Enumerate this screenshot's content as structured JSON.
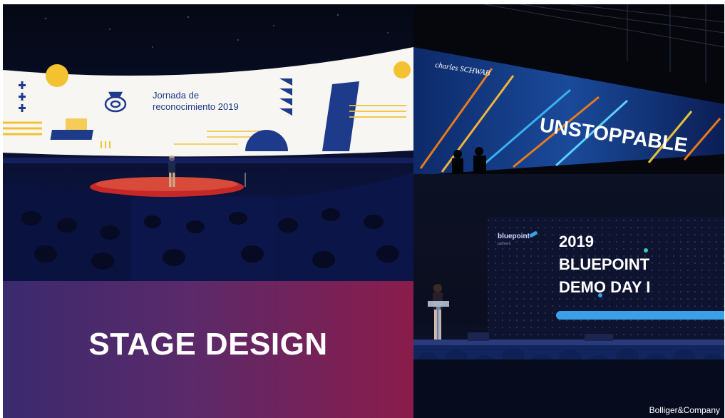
{
  "panels": {
    "correos": {
      "screen_text_line1": "Jornada de",
      "screen_text_line2": "reconocimiento 2019"
    },
    "schwab": {
      "brand": "charles SCHWAB",
      "headline": "UNSTOPPABLE"
    },
    "title": {
      "heading": "STAGE DESIGN"
    },
    "bluepoint": {
      "brand": "bluepoint",
      "brand_sub": "partners",
      "line1": "2019",
      "line2": "BLUEPOINT",
      "line3": "DEMO DAY I",
      "credit": "Bolliger&Company"
    }
  },
  "colors": {
    "correos_yellow": "#f2c230",
    "correos_blue": "#1e3a8a",
    "title_gradient_start": "#3a2a6e",
    "title_gradient_end": "#8a1c4a",
    "bluepoint_accent": "#3aa0e8"
  }
}
